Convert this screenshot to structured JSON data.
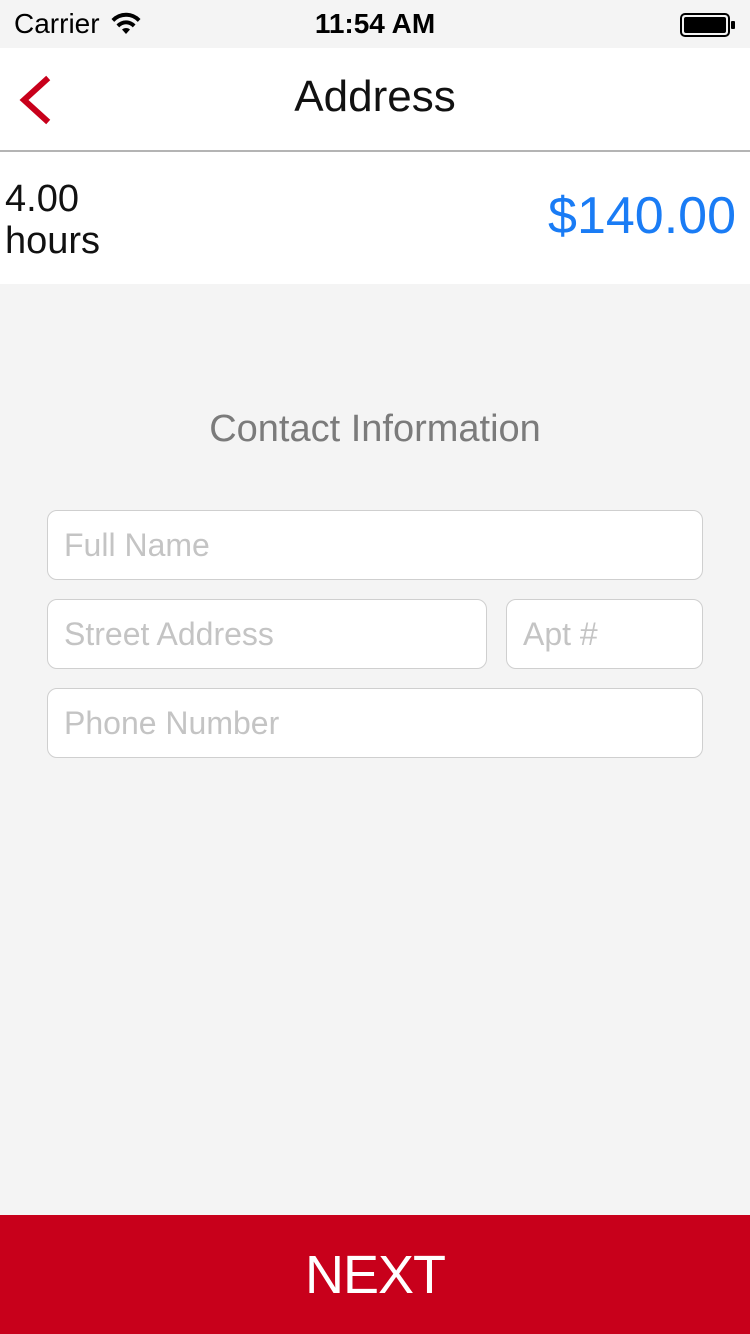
{
  "status_bar": {
    "carrier": "Carrier",
    "time": "11:54 AM",
    "wifi_icon": "wifi-icon",
    "battery_icon": "battery-full-icon"
  },
  "nav": {
    "title": "Address",
    "back_icon": "chevron-left-icon"
  },
  "summary": {
    "hours": "4.00 hours",
    "price": "$140.00"
  },
  "contact": {
    "title": "Contact Information",
    "full_name_placeholder": "Full Name",
    "street_placeholder": "Street Address",
    "apt_placeholder": "Apt #",
    "phone_placeholder": "Phone Number"
  },
  "footer": {
    "next_label": "NEXT"
  },
  "colors": {
    "accent": "#c8001b",
    "price": "#1a7cf5",
    "background": "#f4f4f4"
  }
}
